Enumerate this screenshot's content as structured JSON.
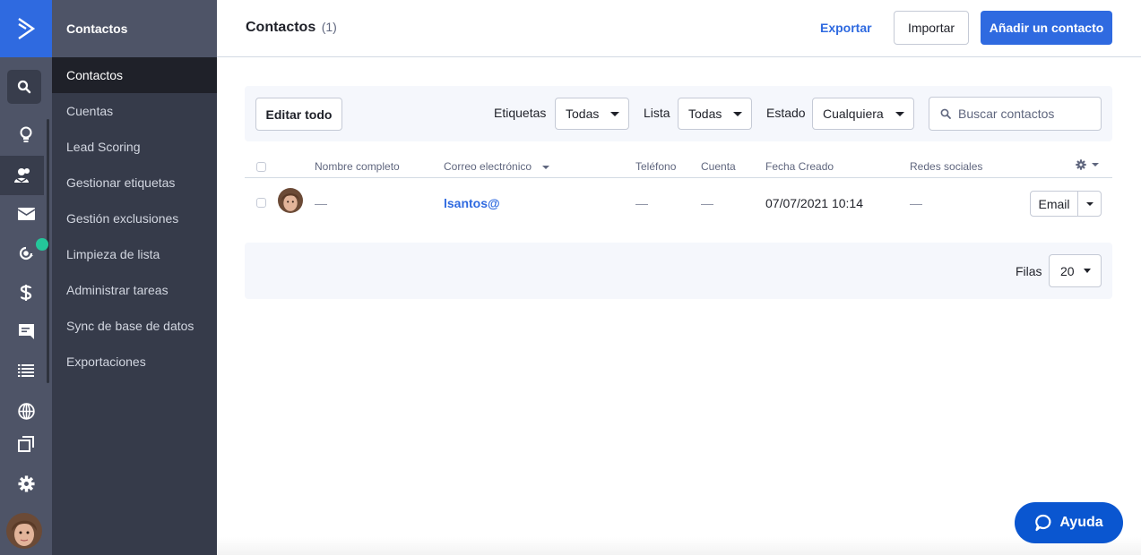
{
  "rail": {
    "items": [
      {
        "name": "search-icon"
      },
      {
        "name": "lightbulb-icon"
      },
      {
        "name": "contacts-icon",
        "active": true
      },
      {
        "name": "email-icon"
      },
      {
        "name": "automation-icon",
        "notification": true
      },
      {
        "name": "dollar-icon"
      },
      {
        "name": "chat-icon"
      },
      {
        "name": "list-icon"
      },
      {
        "name": "globe-icon"
      },
      {
        "name": "pages-icon"
      },
      {
        "name": "gear-icon"
      }
    ]
  },
  "subnav": {
    "title": "Contactos",
    "items": [
      {
        "label": "Contactos",
        "active": true
      },
      {
        "label": "Cuentas"
      },
      {
        "label": "Lead Scoring"
      },
      {
        "label": "Gestionar etiquetas"
      },
      {
        "label": "Gestión exclusiones"
      },
      {
        "label": "Limpieza de lista"
      },
      {
        "label": "Administrar tareas"
      },
      {
        "label": "Sync de base de datos"
      },
      {
        "label": "Exportaciones"
      }
    ]
  },
  "header": {
    "title": "Contactos",
    "count": "(1)",
    "export_label": "Exportar",
    "import_label": "Importar",
    "add_label": "Añadir un contacto"
  },
  "filters": {
    "edit_all_label": "Editar todo",
    "tags_label": "Etiquetas",
    "tags_value": "Todas",
    "list_label": "Lista",
    "list_value": "Todas",
    "status_label": "Estado",
    "status_value": "Cualquiera",
    "search_placeholder": "Buscar contactos"
  },
  "table": {
    "columns": [
      "Nombre completo",
      "Correo electrónico",
      "Teléfono",
      "Cuenta",
      "Fecha Creado",
      "Redes sociales"
    ],
    "rows": [
      {
        "name": "—",
        "email": "lsantos@",
        "phone": "—",
        "account": "—",
        "created": "07/07/2021 10:14",
        "social": "—",
        "action_label": "Email"
      }
    ]
  },
  "pagination": {
    "rows_label": "Filas",
    "rows_value": "20"
  },
  "help": {
    "label": "Ayuda"
  },
  "colors": {
    "brand": "#2f6ae0",
    "rail": "#4e5467",
    "subnav": "#363b4a",
    "notification": "#24c69a",
    "help": "#0a56d0"
  }
}
